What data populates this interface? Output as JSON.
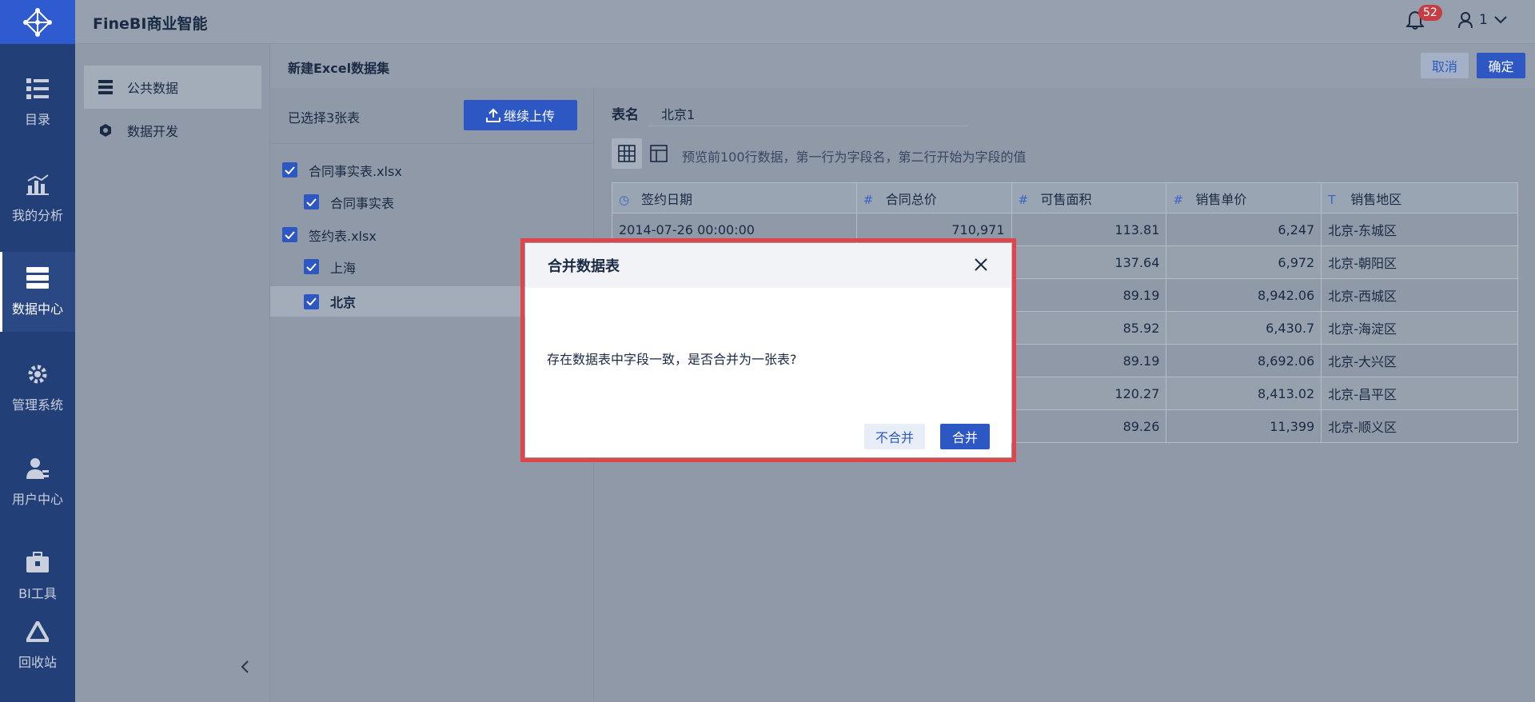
{
  "app": {
    "brand": "FineBI商业智能"
  },
  "header": {
    "notification_count": "52",
    "user_name": "1"
  },
  "nav": {
    "items": [
      {
        "label": "目录",
        "icon": "catalog-icon"
      },
      {
        "label": "我的分析",
        "icon": "analysis-icon"
      },
      {
        "label": "数据中心",
        "icon": "data-center-icon",
        "active": true
      },
      {
        "label": "管理系统",
        "icon": "gear-icon"
      },
      {
        "label": "用户中心",
        "icon": "user-icon"
      },
      {
        "label": "BI工具",
        "icon": "toolbox-icon"
      },
      {
        "label": "回收站",
        "icon": "recycle-icon"
      }
    ]
  },
  "left_panel": {
    "items": [
      {
        "label": "公共数据",
        "icon": "public-data-icon",
        "active": true
      },
      {
        "label": "数据开发",
        "icon": "data-dev-icon"
      }
    ]
  },
  "page": {
    "title": "新建Excel数据集",
    "cancel_label": "取消",
    "confirm_label": "确定"
  },
  "files": {
    "selected_text": "已选择3张表",
    "upload_label": "继续上传",
    "tree": [
      {
        "label": "合同事实表.xlsx",
        "checked": true
      },
      {
        "label": "合同事实表",
        "checked": true
      },
      {
        "label": "签约表.xlsx",
        "checked": true
      },
      {
        "label": "上海",
        "checked": true
      },
      {
        "label": "北京",
        "checked": true,
        "selected": true
      }
    ]
  },
  "preview": {
    "table_name_label": "表名",
    "table_name_value": "北京1",
    "hint": "预览前100行数据，第一行为字段名，第二行开始为字段的值",
    "columns": [
      {
        "name": "签约日期",
        "type_icon": "◷"
      },
      {
        "name": "合同总价",
        "type_icon": "#"
      },
      {
        "name": "可售面积",
        "type_icon": "#"
      },
      {
        "name": "销售单价",
        "type_icon": "#"
      },
      {
        "name": "销售地区",
        "type_icon": "T"
      }
    ],
    "rows": [
      [
        "2014-07-26 00:00:00",
        "710,971",
        "113.81",
        "6,247",
        "北京-东城区"
      ],
      [
        "",
        "",
        "137.64",
        "6,972",
        "北京-朝阳区"
      ],
      [
        "",
        "",
        "89.19",
        "8,942.06",
        "北京-西城区"
      ],
      [
        "",
        "",
        "85.92",
        "6,430.7",
        "北京-海淀区"
      ],
      [
        "",
        "",
        "89.19",
        "8,692.06",
        "北京-大兴区"
      ],
      [
        "",
        "",
        "120.27",
        "8,413.02",
        "北京-昌平区"
      ],
      [
        "",
        "",
        "89.26",
        "11,399",
        "北京-顺义区"
      ]
    ]
  },
  "dialog": {
    "title": "合并数据表",
    "message": "存在数据表中字段一致，是否合并为一张表?",
    "no_merge_label": "不合并",
    "merge_label": "合并"
  },
  "colors": {
    "accent": "#2d58c4",
    "nav_bg": "#223f78",
    "highlight": "#e04649",
    "overlay": "#8f99a8"
  }
}
